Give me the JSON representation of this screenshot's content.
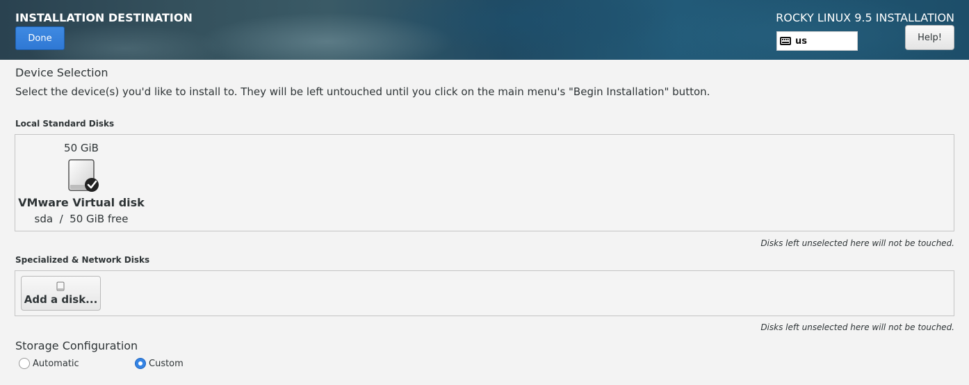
{
  "header": {
    "title": "INSTALLATION DESTINATION",
    "done_label": "Done",
    "product_title": "ROCKY LINUX 9.5 INSTALLATION",
    "keyboard_layout": "us",
    "help_label": "Help!"
  },
  "device_selection": {
    "heading": "Device Selection",
    "description": "Select the device(s) you'd like to install to.  They will be left untouched until you click on the main menu's \"Begin Installation\" button."
  },
  "local_disks": {
    "label": "Local Standard Disks",
    "disks": [
      {
        "capacity": "50 GiB",
        "name": "VMware Virtual disk",
        "detail": "sda  /  50 GiB free",
        "selected": true,
        "icon": "hard-disk-icon"
      }
    ],
    "note": "Disks left unselected here will not be touched."
  },
  "network_disks": {
    "label": "Specialized & Network Disks",
    "add_disk_label": "Add a disk...",
    "add_disk_icon": "hard-disk-icon",
    "note": "Disks left unselected here will not be touched."
  },
  "storage_config": {
    "heading": "Storage Configuration",
    "options": [
      {
        "label": "Automatic",
        "selected": false
      },
      {
        "label": "Custom",
        "selected": true
      }
    ]
  },
  "colors": {
    "accent": "#3584e4",
    "done_button": "#2f78d4",
    "page_background": "#f3f3f3"
  }
}
